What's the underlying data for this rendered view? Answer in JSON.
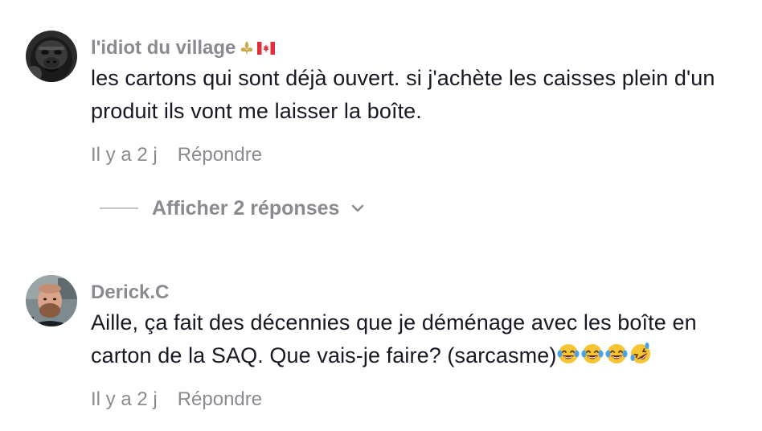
{
  "comments": [
    {
      "username": "l'idiot du village",
      "username_icons": [
        "fleur-de-lis-icon",
        "canada-flag-icon"
      ],
      "text": "les cartons qui sont déjà ouvert. si j'achète les caisses plein d'un produit ils vont me laisser la boîte.",
      "time": "Il y a 2 j",
      "reply_label": "Répondre",
      "view_replies_label": "Afficher 2 réponses"
    },
    {
      "username": "Derick.C",
      "text": "Aille, ça fait des décennies que je déménage avec les boîte en carton de la SAQ. Que vais-je faire? (sarcasme)",
      "text_emojis": [
        "crying-laughing-emoji",
        "crying-laughing-emoji",
        "crying-laughing-emoji",
        "rolling-laughing-emoji"
      ],
      "time": "Il y a 2 j",
      "reply_label": "Répondre"
    }
  ],
  "colors": {
    "secondary_text": "#8a8b91",
    "primary_text": "#161823",
    "divider": "#c4c5c9"
  }
}
